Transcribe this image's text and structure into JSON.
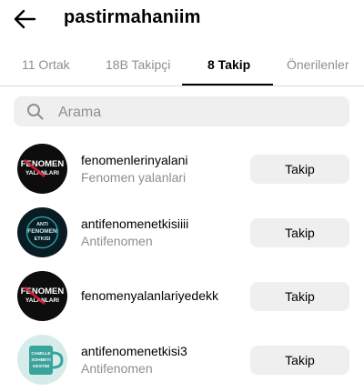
{
  "header": {
    "username": "pastirmahaniim"
  },
  "tabs": [
    {
      "label": "11 Ortak"
    },
    {
      "label": "18B Takipçi"
    },
    {
      "label": "8 Takip",
      "active": true
    },
    {
      "label": "Önerilenler"
    }
  ],
  "search": {
    "placeholder": "Arama",
    "value": ""
  },
  "accounts": [
    {
      "username": "fenomenlerinyalani",
      "display_name": "Fenomen yalanlari",
      "button": "Takip",
      "avatar_text_1": "FENOMEN",
      "avatar_text_2": "YALANLARI"
    },
    {
      "username": "antifenomenetkisiiii",
      "display_name": "Antifenomen",
      "button": "Takip",
      "avatar_text_1": "ANTI",
      "avatar_text_2": "FENOMEN",
      "avatar_text_3": "ETKISI"
    },
    {
      "username": "fenomenyalanlariyedekk",
      "display_name": "",
      "button": "Takip",
      "avatar_text_1": "FENOMEN",
      "avatar_text_2": "YALANLARI"
    },
    {
      "username": "antifenomenetkisi3",
      "display_name": "Antifenomen",
      "button": "Takip",
      "avatar_text_1": "CAMILLE",
      "avatar_text_2": "SOHBETI",
      "avatar_text_3": "KESTIM"
    }
  ],
  "colors": {
    "primary_text": "#000000",
    "secondary_text": "#8e8e8e",
    "button_bg": "#efefef",
    "divider": "#dbdbdb"
  }
}
